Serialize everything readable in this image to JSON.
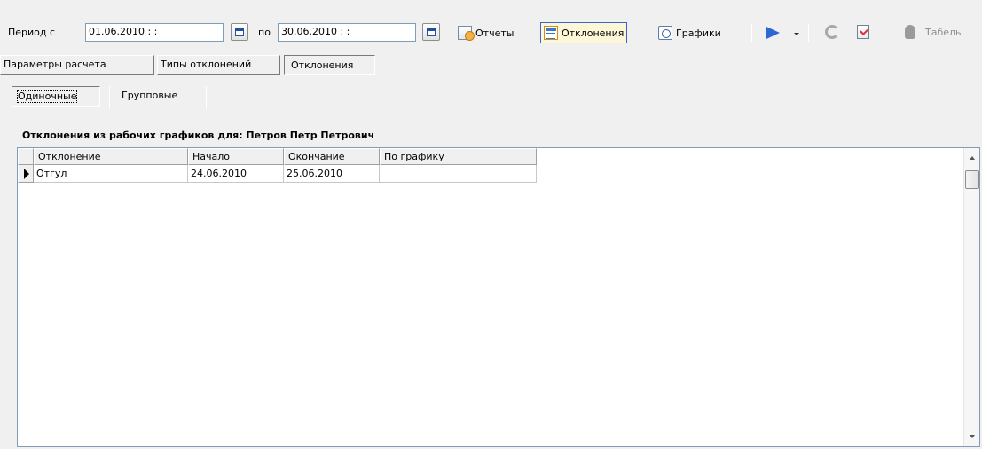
{
  "toolbar": {
    "period_from_label": "Период с",
    "period_from_value": "01.06.2010  : :",
    "period_to_label": "по",
    "period_to_value": "30.06.2010  : :",
    "reports_label": "Отчеты",
    "deviations_label": "Отклонения",
    "graphs_label": "Графики",
    "tabel_label": "Табель"
  },
  "tabs": [
    {
      "label": "Параметры расчета"
    },
    {
      "label": "Типы отклонений"
    },
    {
      "label": "Отклонения"
    }
  ],
  "subtabs": [
    {
      "label": "Одиночные"
    },
    {
      "label": "Групповые"
    }
  ],
  "section_caption": "Отклонения из рабочих графиков для: Петров Петр Петрович",
  "grid": {
    "columns": [
      "Отклонение",
      "Начало",
      "Окончание",
      "По графику"
    ],
    "rows": [
      {
        "deviation": "Отгул",
        "start": "24.06.2010",
        "end": "25.06.2010",
        "by_schedule": ""
      }
    ]
  }
}
